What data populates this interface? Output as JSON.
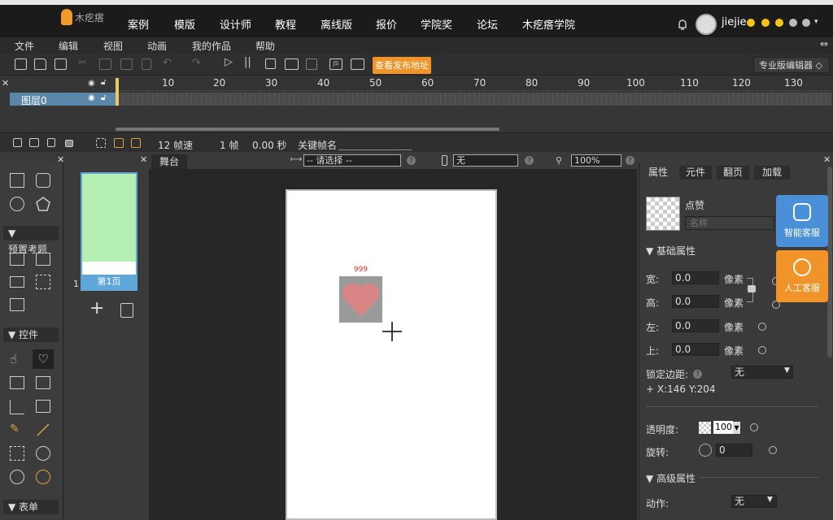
{
  "nav": {
    "logo_text": "木疙瘩",
    "items": [
      "案例",
      "模版",
      "设计师",
      "教程",
      "离线版",
      "报价",
      "学院奖",
      "论坛",
      "木疙瘩学院"
    ],
    "username": "jiejie"
  },
  "menubar": [
    "文件",
    "编辑",
    "视图",
    "动画",
    "我的作品",
    "帮助"
  ],
  "toolbar": {
    "publish_label": "查看发布地址",
    "editor_mode": "专业版编辑器 ◇"
  },
  "timeline": {
    "ticks": [
      "10",
      "20",
      "30",
      "40",
      "50",
      "60",
      "70",
      "80",
      "90",
      "100",
      "110",
      "120",
      "130"
    ],
    "layer_name": "图层0",
    "fps": "12 帧速",
    "frame": "1 帧",
    "time": "0.00 秒",
    "keyframe_label": "关键帧名"
  },
  "lefttools": {
    "preset_head": "预置考题",
    "controls_head": "控件",
    "form_head": "表单"
  },
  "pages": {
    "number": "1",
    "page_label": "第1页",
    "add": "+"
  },
  "stage": {
    "tab": "舞台",
    "device_select": "-- 请选择 --",
    "orientation_select": "无",
    "zoom": "100%",
    "like_count": "999"
  },
  "properties": {
    "tabs": [
      "属性",
      "元件",
      "翻页",
      "加载"
    ],
    "element_name": "点赞",
    "name_placeholder": "名称",
    "basic_head": "基础属性",
    "width_label": "宽:",
    "width_value": "0.0",
    "height_label": "高:",
    "height_value": "0.0",
    "left_label": "左:",
    "left_value": "0.0",
    "top_label": "上:",
    "top_value": "0.0",
    "unit": "像素",
    "lock_margin_label": "锁定边距:",
    "lock_margin_value": "无",
    "coords": "+ X:146   Y:204",
    "opacity_label": "透明度:",
    "opacity_value": "100",
    "rotation_label": "旋转:",
    "rotation_value": "0",
    "advanced_head": "高级属性",
    "action_label": "动作:",
    "action_value": "无"
  },
  "float": {
    "smart_service": "智能客服",
    "human_service": "人工客服"
  },
  "colors": {
    "accent": "#f0942a",
    "blue": "#5fa7d9",
    "heart": "#d98585"
  }
}
